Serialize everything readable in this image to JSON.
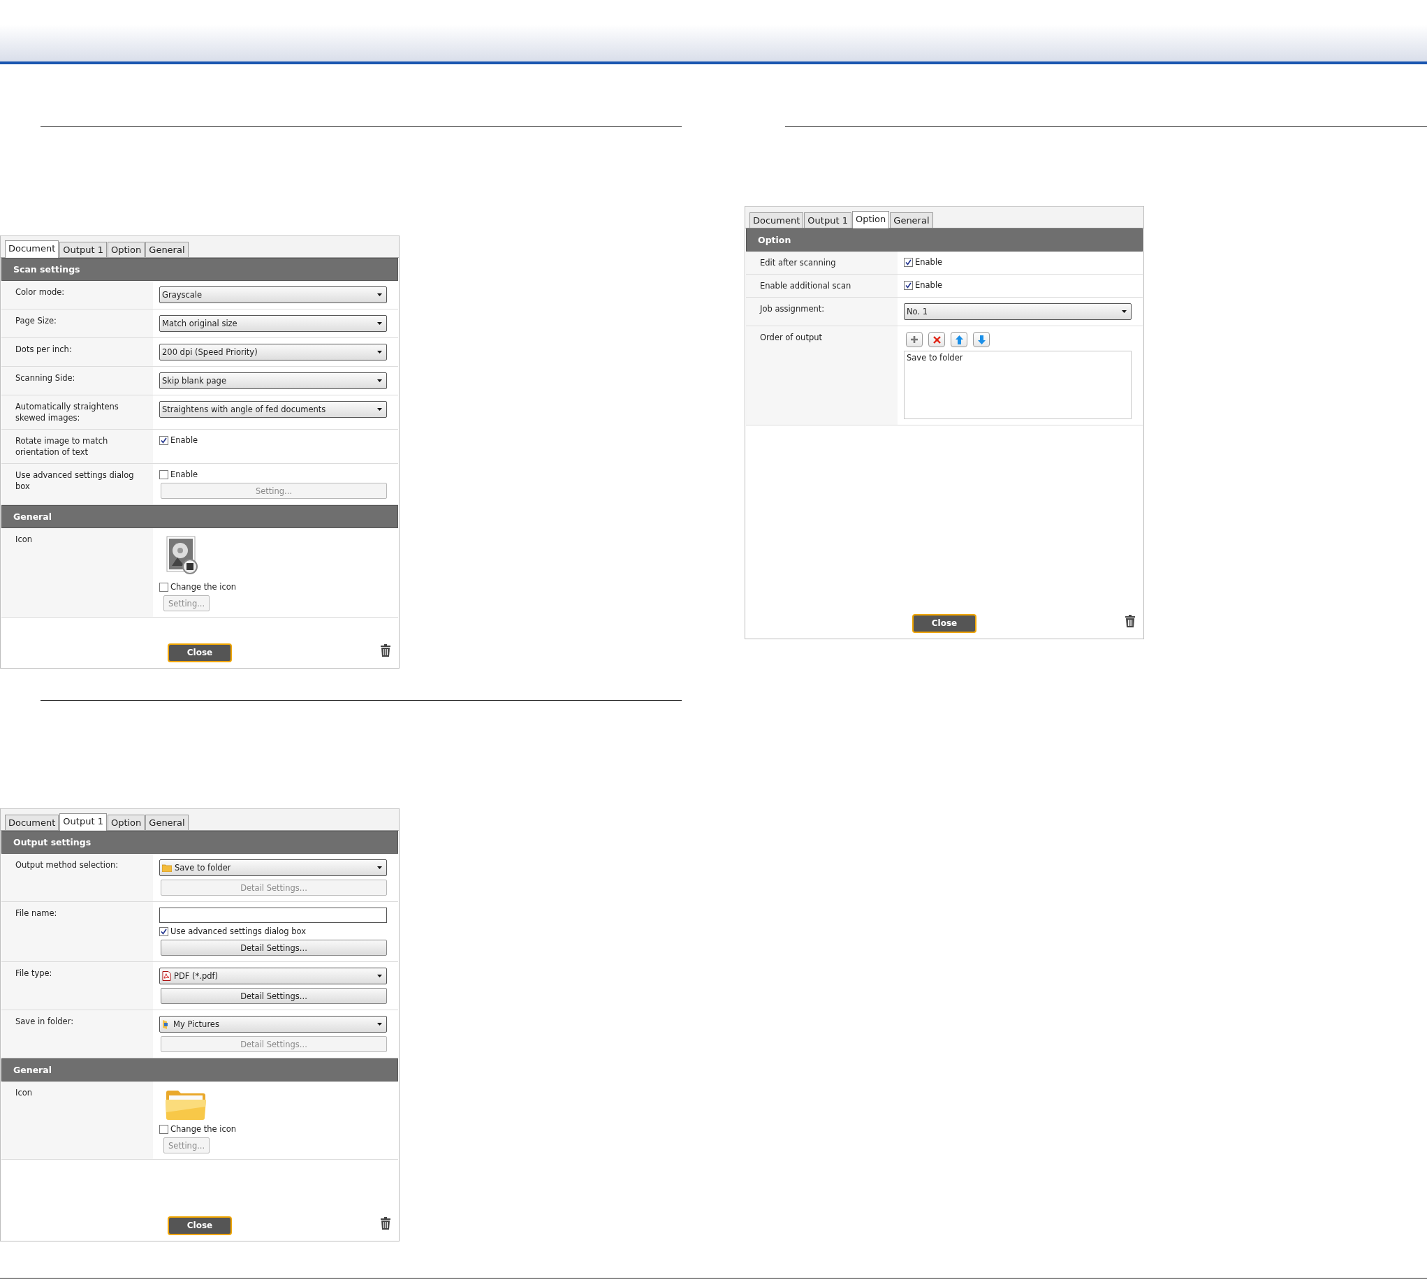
{
  "dialogs": [
    {
      "tabs": [
        {
          "label": "Document",
          "selected": true
        },
        {
          "label": "Output 1",
          "selected": false
        },
        {
          "label": "Option",
          "selected": false
        },
        {
          "label": "General",
          "selected": false
        }
      ],
      "sections": [
        {
          "title": "Scan settings",
          "rows": [
            {
              "label": "Color mode:",
              "controls": [
                {
                  "kind": "dropdown",
                  "value": "Grayscale"
                }
              ]
            },
            {
              "label": "Page Size:",
              "controls": [
                {
                  "kind": "dropdown",
                  "value": "Match original size"
                }
              ]
            },
            {
              "label": "Dots per inch:",
              "controls": [
                {
                  "kind": "dropdown",
                  "value": "200 dpi (Speed Priority)"
                }
              ]
            },
            {
              "label": "Scanning Side:",
              "controls": [
                {
                  "kind": "dropdown",
                  "value": "Skip blank page"
                }
              ]
            },
            {
              "label": "Automatically straightens skewed images:",
              "controls": [
                {
                  "kind": "dropdown",
                  "value": "Straightens with angle of fed documents"
                }
              ]
            },
            {
              "label": "Rotate image to match orientation of text",
              "controls": [
                {
                  "kind": "checkbox",
                  "label": "Enable",
                  "checked": true
                }
              ]
            },
            {
              "label": "Use advanced settings dialog box",
              "controls": [
                {
                  "kind": "checkbox",
                  "label": "Enable",
                  "checked": false
                },
                {
                  "kind": "button",
                  "label": "Setting...",
                  "disabled": true
                }
              ]
            }
          ]
        },
        {
          "title": "General",
          "rows": [
            {
              "label": "Icon",
              "controls": [
                {
                  "kind": "photo-image"
                },
                {
                  "kind": "checkbox",
                  "label": "Change the icon",
                  "checked": false
                },
                {
                  "kind": "small-button",
                  "label": "Setting...",
                  "disabled": true
                }
              ]
            }
          ]
        }
      ],
      "close": "Close"
    },
    {
      "tabs": [
        {
          "label": "Document",
          "selected": false
        },
        {
          "label": "Output 1",
          "selected": false
        },
        {
          "label": "Option",
          "selected": true
        },
        {
          "label": "General",
          "selected": false
        }
      ],
      "sections": [
        {
          "title": "Option",
          "rows": [
            {
              "label": "Edit after scanning",
              "controls": [
                {
                  "kind": "checkbox",
                  "label": "Enable",
                  "checked": true
                }
              ]
            },
            {
              "label": "Enable additional scan",
              "controls": [
                {
                  "kind": "checkbox",
                  "label": "Enable",
                  "checked": true
                }
              ]
            },
            {
              "label": "Job assignment:",
              "controls": [
                {
                  "kind": "dropdown",
                  "value": "No. 1"
                }
              ]
            },
            {
              "label": "Order of output",
              "controls": [
                {
                  "kind": "toolbar",
                  "buttons": [
                    {
                      "kind": "add"
                    },
                    {
                      "kind": "remove"
                    },
                    {
                      "kind": "up"
                    },
                    {
                      "kind": "down"
                    }
                  ]
                },
                {
                  "kind": "listbox",
                  "items": [
                    "Save to folder"
                  ]
                }
              ]
            }
          ]
        }
      ],
      "close": "Close"
    },
    {
      "tabs": [
        {
          "label": "Document",
          "selected": false
        },
        {
          "label": "Output 1",
          "selected": true
        },
        {
          "label": "Option",
          "selected": false
        },
        {
          "label": "General",
          "selected": false
        }
      ],
      "sections": [
        {
          "title": "Output settings",
          "rows": [
            {
              "label": "Output method selection:",
              "controls": [
                {
                  "kind": "dropdown-folder",
                  "value": "Save to folder"
                },
                {
                  "kind": "button",
                  "label": "Detail Settings...",
                  "disabled": true
                }
              ]
            },
            {
              "label": "File name:",
              "controls": [
                {
                  "kind": "textbox"
                },
                {
                  "kind": "checkbox",
                  "label": "Use advanced settings dialog box",
                  "checked": true
                },
                {
                  "kind": "button",
                  "label": "Detail Settings...",
                  "disabled": false
                }
              ]
            },
            {
              "label": "File type:",
              "controls": [
                {
                  "kind": "dropdown-pdf",
                  "value": "PDF (*.pdf)"
                },
                {
                  "kind": "button",
                  "label": "Detail Settings...",
                  "disabled": false
                }
              ]
            },
            {
              "label": "Save in folder:",
              "controls": [
                {
                  "kind": "dropdown-pictures",
                  "value": "My Pictures"
                },
                {
                  "kind": "button",
                  "label": "Detail Settings...",
                  "disabled": true
                }
              ]
            }
          ]
        },
        {
          "title": "General",
          "rows": [
            {
              "label": "Icon",
              "controls": [
                {
                  "kind": "folder-image"
                },
                {
                  "kind": "checkbox",
                  "label": "Change the icon",
                  "checked": false
                },
                {
                  "kind": "small-button",
                  "label": "Setting...",
                  "disabled": true
                }
              ]
            }
          ]
        }
      ],
      "close": "Close"
    }
  ]
}
